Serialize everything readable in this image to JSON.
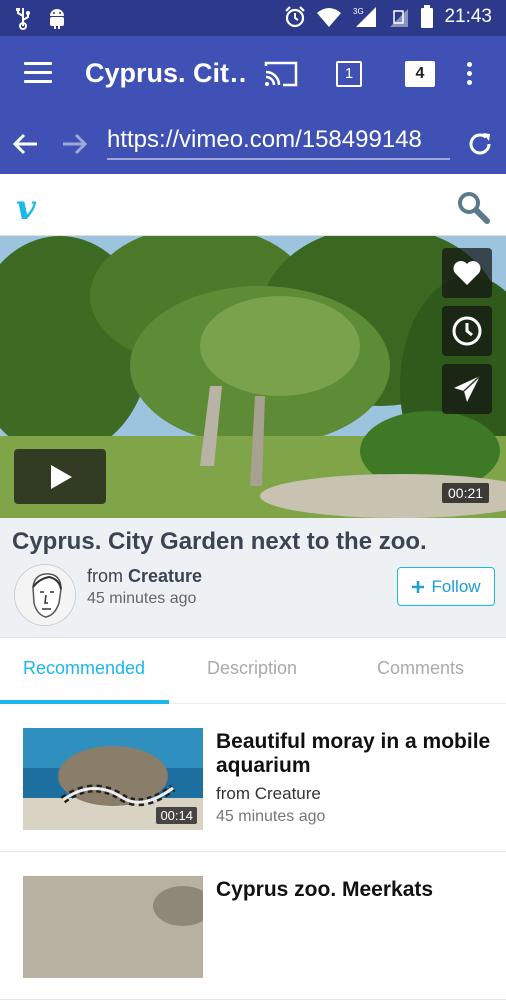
{
  "status_bar": {
    "time": "21:43",
    "network": "3G"
  },
  "toolbar": {
    "title": "Cyprus. Cit…",
    "tab_count_1": "1",
    "tab_count_2": "4"
  },
  "url_bar": {
    "url": "https://vimeo.com/158499148"
  },
  "site": {
    "logo": "v"
  },
  "video": {
    "duration": "00:21"
  },
  "info": {
    "title": "Cyprus. City Garden next to the zoo.",
    "from_prefix": "from",
    "author": "Creature",
    "posted": "45 minutes ago",
    "follow_label": "Follow"
  },
  "tabs": [
    {
      "label": "Recommended",
      "active": true
    },
    {
      "label": "Description",
      "active": false
    },
    {
      "label": "Comments",
      "active": false
    }
  ],
  "recommended": [
    {
      "title": "Beautiful moray in a mobile aquarium",
      "from": "from Creature",
      "posted": "45 minutes ago",
      "duration": "00:14"
    },
    {
      "title": "Cyprus zoo. Meerkats",
      "from": "",
      "posted": "",
      "duration": ""
    }
  ],
  "colors": {
    "toolbar": "#3f51b5",
    "statusbar": "#2d3a8c",
    "accent": "#1ab7ea"
  }
}
